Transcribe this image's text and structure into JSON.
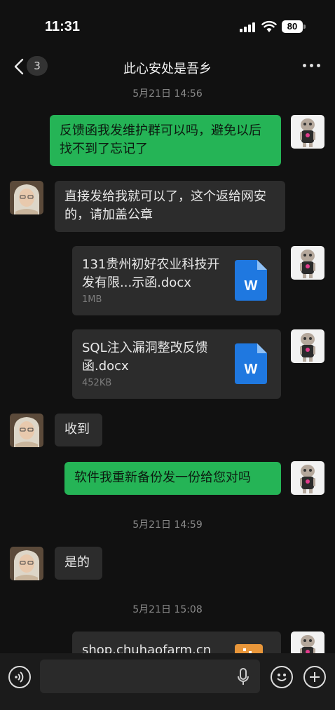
{
  "status": {
    "time": "11:31",
    "battery": "80"
  },
  "nav": {
    "badge": "3",
    "title": "此心安处是吾乡"
  },
  "messages": {
    "ts1": "5月21日 14:56",
    "m1": "反馈函我发维护群可以吗，避免以后找不到了忘记了",
    "m2": "直接发给我就可以了，这个返给网安的，请加盖公章",
    "f1_name": "131贵州初好农业科技开发有限...示函.docx",
    "f1_size": "1MB",
    "f2_name": "SQL注入漏洞整改反馈函.docx",
    "f2_size": "452KB",
    "m3": "收到",
    "m4": "软件我重新备份发一份给您对吗",
    "ts2": "5月21日 14:59",
    "m5": "是的",
    "ts3": "5月21日 15:08",
    "m6": "shop.chuhaofarm.cn"
  },
  "colors": {
    "accent": "#25b456",
    "bubble_gray": "#2c2c2c",
    "background": "#111111",
    "word_blue": "#1f78e0"
  },
  "icons": [
    "back-chevron-icon",
    "more-dots-icon",
    "word-doc-icon",
    "voice-icon",
    "mic-icon",
    "emoji-icon",
    "plus-icon",
    "signal-icon",
    "wifi-icon"
  ]
}
